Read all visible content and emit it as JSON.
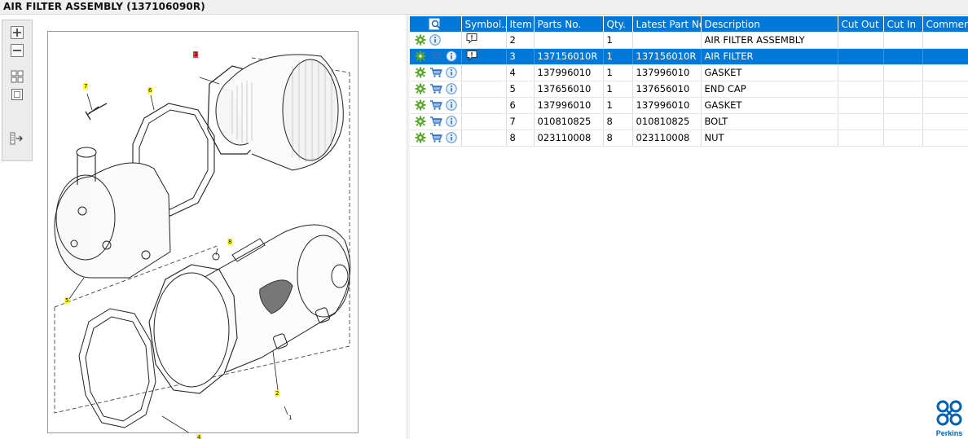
{
  "window": {
    "title": "AIR FILTER ASSEMBLY (137106090R)"
  },
  "toolbar": {
    "buttons": [
      {
        "name": "zoom-in",
        "icon": "zoom-in-icon"
      },
      {
        "name": "zoom-out",
        "icon": "zoom-out-icon"
      },
      {
        "name": "fit-all",
        "icon": "fit-all-icon"
      },
      {
        "name": "fit-window",
        "icon": "fit-window-icon"
      },
      {
        "name": "export",
        "icon": "export-icon"
      }
    ]
  },
  "drawing": {
    "callouts": [
      {
        "label": "3",
        "highlight": "red"
      },
      {
        "label": "7",
        "highlight": "yellow"
      },
      {
        "label": "6",
        "highlight": "yellow"
      },
      {
        "label": "8",
        "highlight": "yellow"
      },
      {
        "label": "5",
        "highlight": "yellow"
      },
      {
        "label": "2",
        "highlight": "yellow"
      },
      {
        "label": "4",
        "highlight": "yellow"
      },
      {
        "label": "1",
        "highlight": "none"
      }
    ]
  },
  "table": {
    "columns": [
      "Symbol...",
      "Item",
      "Parts No.",
      "Qty.",
      "Latest Part No.",
      "Description",
      "Cut Out",
      "Cut In",
      "Comment"
    ],
    "rows": [
      {
        "item": "2",
        "part_no": "",
        "qty": "1",
        "latest": "",
        "description": "AIR FILTER ASSEMBLY",
        "cart": false,
        "symbol": true,
        "selected": false
      },
      {
        "item": "3",
        "part_no": "137156010R",
        "qty": "1",
        "latest": "137156010R",
        "description": "AIR FILTER",
        "cart": true,
        "symbol": true,
        "selected": true
      },
      {
        "item": "4",
        "part_no": "137996010",
        "qty": "1",
        "latest": "137996010",
        "description": "GASKET",
        "cart": true,
        "symbol": false,
        "selected": false
      },
      {
        "item": "5",
        "part_no": "137656010",
        "qty": "1",
        "latest": "137656010",
        "description": "END CAP",
        "cart": true,
        "symbol": false,
        "selected": false
      },
      {
        "item": "6",
        "part_no": "137996010",
        "qty": "1",
        "latest": "137996010",
        "description": "GASKET",
        "cart": true,
        "symbol": false,
        "selected": false
      },
      {
        "item": "7",
        "part_no": "010810825",
        "qty": "8",
        "latest": "010810825",
        "description": "BOLT",
        "cart": true,
        "symbol": false,
        "selected": false
      },
      {
        "item": "8",
        "part_no": "023110008",
        "qty": "8",
        "latest": "023110008",
        "description": "NUT",
        "cart": true,
        "symbol": false,
        "selected": false
      }
    ]
  },
  "brand": {
    "name": "Perkins",
    "color": "#0062b0"
  },
  "colors": {
    "selection": "#0078d7",
    "header": "#0078d7",
    "gear": "#5aa832",
    "info": "#4a90d9",
    "callout_yellow": "#ffff33",
    "callout_red": "#f03c3c"
  }
}
